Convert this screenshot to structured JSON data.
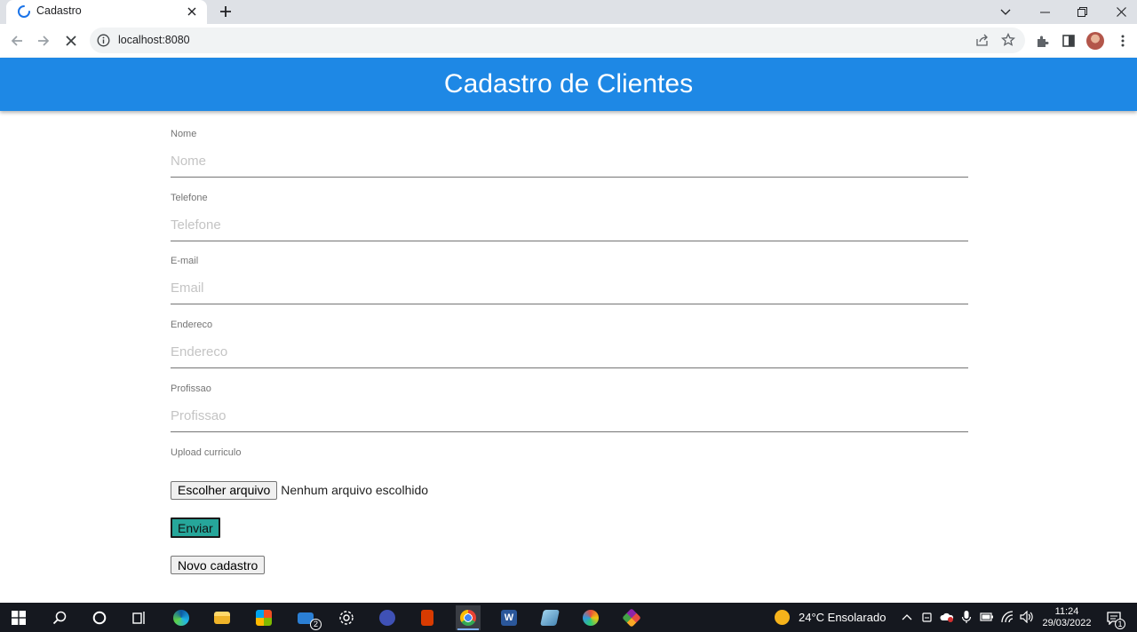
{
  "browser": {
    "tab_title": "Cadastro",
    "url": "localhost:8080"
  },
  "page": {
    "header_title": "Cadastro de Clientes",
    "fields": [
      {
        "label": "Nome",
        "placeholder": "Nome"
      },
      {
        "label": "Telefone",
        "placeholder": "Telefone"
      },
      {
        "label": "E-mail",
        "placeholder": "Email"
      },
      {
        "label": "Endereco",
        "placeholder": "Endereco"
      },
      {
        "label": "Profissao",
        "placeholder": "Profissao"
      }
    ],
    "upload_label": "Upload curriculo",
    "file_button": "Escolher arquivo",
    "file_status": "Nenhum arquivo escolhido",
    "submit_button": "Enviar",
    "new_button": "Novo cadastro",
    "colors": {
      "header": "#1e88e5",
      "submit": "#26a69a"
    }
  },
  "taskbar": {
    "weather": "24°C  Ensolarado",
    "time": "11:24",
    "date": "29/03/2022",
    "mail_badge": "2",
    "notification_badge": "1"
  }
}
